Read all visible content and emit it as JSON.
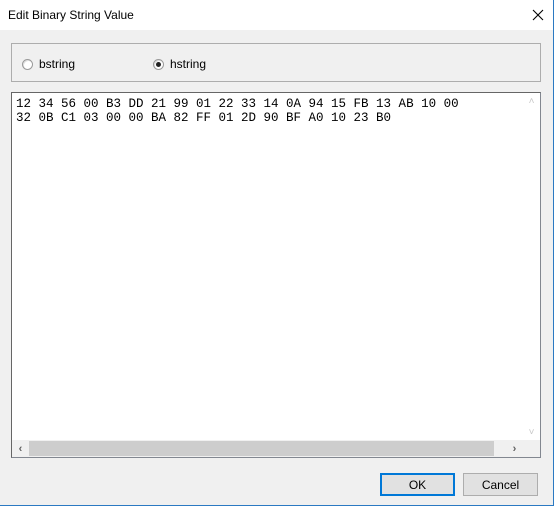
{
  "window": {
    "title": "Edit Binary String Value",
    "close_icon": "close-icon",
    "accent_color": "#2b79c2"
  },
  "format": {
    "options": [
      {
        "label": "bstring",
        "selected": false
      },
      {
        "label": "hstring",
        "selected": true
      }
    ]
  },
  "editor": {
    "lines": [
      "12 34 56 00 B3 DD 21 99 01 22 33 14 0A 94 15 FB 13 AB 10 00",
      "32 0B C1 03 00 00 BA 82 FF 01 2D 90 BF A0 10 23 B0"
    ],
    "scroll_up_icon": "chevron-up-icon",
    "scroll_down_icon": "chevron-down-icon",
    "scroll_left_icon": "chevron-left-icon",
    "scroll_right_icon": "chevron-right-icon",
    "scroll_up_glyph": "˄",
    "scroll_down_glyph": "˅",
    "scroll_left_glyph": "‹",
    "scroll_right_glyph": "›"
  },
  "buttons": {
    "ok_label": "OK",
    "cancel_label": "Cancel"
  }
}
